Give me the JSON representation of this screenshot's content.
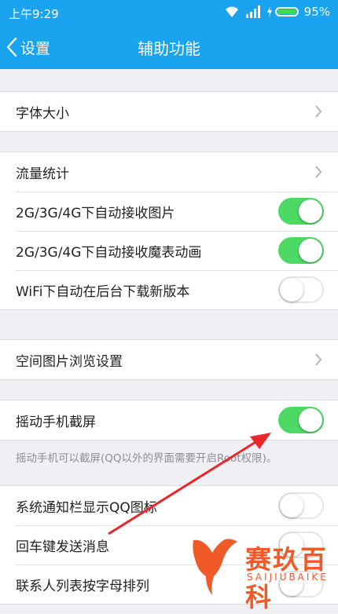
{
  "status_bar": {
    "time": "上午9:29",
    "battery_percent": "95%"
  },
  "nav": {
    "back_label": "设置",
    "title": "辅助功能"
  },
  "groups": [
    {
      "rows": [
        {
          "label": "字体大小",
          "control": "chevron"
        }
      ]
    },
    {
      "rows": [
        {
          "label": "流量统计",
          "control": "chevron"
        },
        {
          "label": "2G/3G/4G下自动接收图片",
          "control": "toggle",
          "on": true
        },
        {
          "label": "2G/3G/4G下自动接收魔表动画",
          "control": "toggle",
          "on": true
        },
        {
          "label": "WiFi下自动在后台下载新版本",
          "control": "toggle",
          "on": false
        }
      ]
    },
    {
      "rows": [
        {
          "label": "空间图片浏览设置",
          "control": "chevron"
        }
      ]
    },
    {
      "rows": [
        {
          "label": "摇动手机截屏",
          "control": "toggle",
          "on": true
        }
      ]
    },
    {
      "rows": [
        {
          "label": "系统通知栏显示QQ图标",
          "control": "toggle",
          "on": false
        },
        {
          "label": "回车键发送消息",
          "control": "toggle",
          "on": false
        },
        {
          "label": "联系人列表按字母排列",
          "control": "toggle",
          "on": false
        }
      ]
    }
  ],
  "shake_hint": "摇动手机可以截屏(QQ以外的界面需要开启Root权限)。",
  "watermark": {
    "cn": "赛玖百科",
    "en": "SAIJIUBAIKE"
  },
  "colors": {
    "header": "#1aa3ee",
    "toggle_on": "#4cd964",
    "watermark": "#f05a28",
    "arrow": "#e8262c"
  }
}
